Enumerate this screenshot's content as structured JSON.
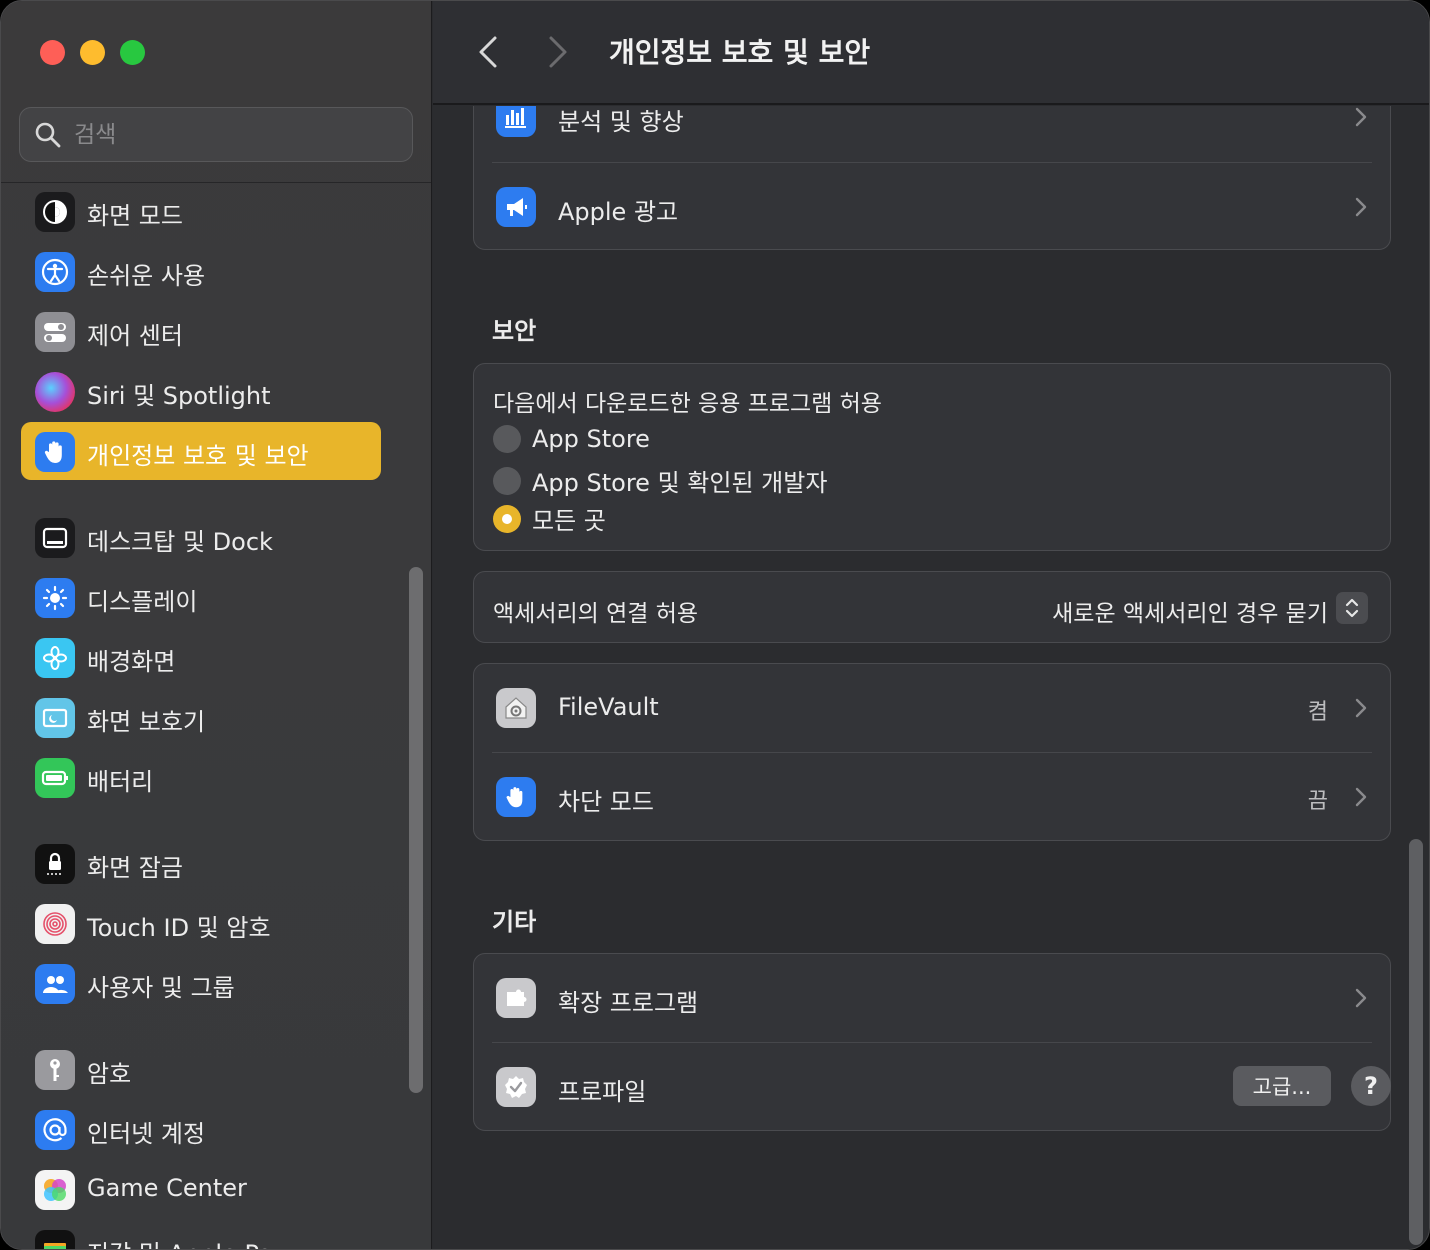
{
  "window": {
    "title": "개인정보 보호 및 보안"
  },
  "search": {
    "placeholder": "검색",
    "value": ""
  },
  "sidebar": {
    "items": [
      {
        "label": "화면 모드",
        "icon": "appearance-icon"
      },
      {
        "label": "손쉬운 사용",
        "icon": "accessibility-icon"
      },
      {
        "label": "제어 센터",
        "icon": "control-center-icon"
      },
      {
        "label": "Siri 및 Spotlight",
        "icon": "siri-icon"
      },
      {
        "label": "개인정보 보호 및 보안",
        "icon": "privacy-hand-icon",
        "selected": true
      },
      {
        "label": "데스크탑 및 Dock",
        "icon": "desktop-dock-icon"
      },
      {
        "label": "디스플레이",
        "icon": "display-icon"
      },
      {
        "label": "배경화면",
        "icon": "wallpaper-icon"
      },
      {
        "label": "화면 보호기",
        "icon": "screensaver-icon"
      },
      {
        "label": "배터리",
        "icon": "battery-icon"
      },
      {
        "label": "화면 잠금",
        "icon": "lock-screen-icon"
      },
      {
        "label": "Touch ID 및 암호",
        "icon": "fingerprint-icon"
      },
      {
        "label": "사용자 및 그룹",
        "icon": "users-icon"
      },
      {
        "label": "암호",
        "icon": "key-icon"
      },
      {
        "label": "인터넷 계정",
        "icon": "at-icon"
      },
      {
        "label": "Game Center",
        "icon": "game-center-icon"
      },
      {
        "label": "지갑 및 Apple Pay",
        "icon": "wallet-icon"
      }
    ]
  },
  "main": {
    "top_group": {
      "rows": [
        {
          "label": "분석 및 향상",
          "icon": "analytics-icon"
        },
        {
          "label": "Apple 광고",
          "icon": "megaphone-icon"
        }
      ]
    },
    "security": {
      "title": "보안",
      "downloads_title": "다음에서 다운로드한 응용 프로그램 허용",
      "options": [
        {
          "label": "App Store",
          "selected": false
        },
        {
          "label": "App Store 및 확인된 개발자",
          "selected": false
        },
        {
          "label": "모든 곳",
          "selected": true
        }
      ],
      "accessory_label": "액세서리의 연결 허용",
      "accessory_value": "새로운 액세서리인 경우 묻기",
      "rows": [
        {
          "label": "FileVault",
          "value": "켬",
          "icon": "filevault-icon"
        },
        {
          "label": "차단 모드",
          "value": "끔",
          "icon": "lockdown-hand-icon"
        }
      ]
    },
    "other": {
      "title": "기타",
      "rows": [
        {
          "label": "확장 프로그램",
          "icon": "extension-icon"
        },
        {
          "label": "프로파일",
          "icon": "profile-check-icon"
        }
      ]
    },
    "buttons": {
      "advanced": "고급...",
      "help": "?"
    }
  },
  "colors": {
    "accent": "#e8b52a",
    "sidebar_bg": "#3a3a3c",
    "content_bg": "#2b2c2f",
    "group_bg": "#333438"
  }
}
